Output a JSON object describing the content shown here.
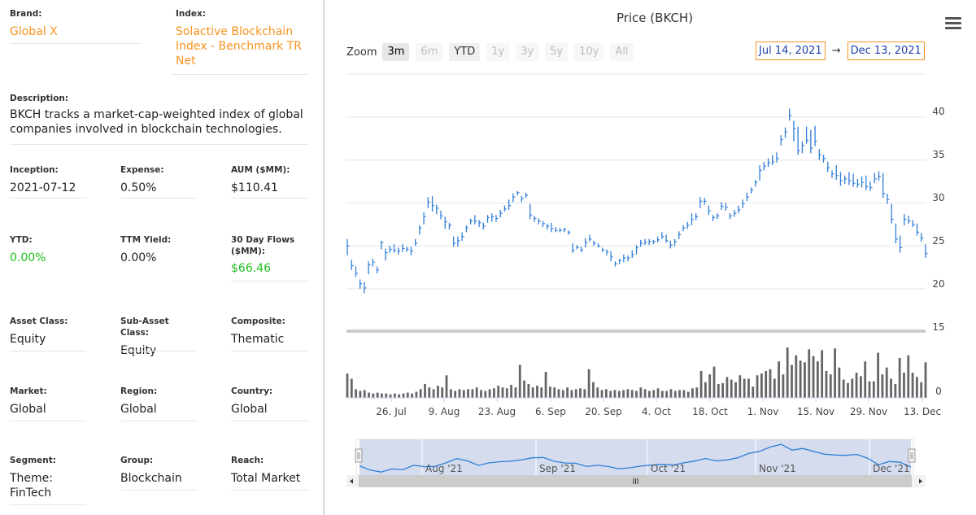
{
  "info": {
    "brand": {
      "label": "Brand:",
      "value": "Global X"
    },
    "index": {
      "label": "Index:",
      "value_lines": [
        "Solactive Blockchain",
        "Index - Benchmark TR",
        "Net"
      ]
    },
    "description": {
      "label": "Description:",
      "value_lines": [
        "BKCH tracks a market-cap-weighted index of global",
        "companies involved in blockchain technologies."
      ]
    },
    "inception": {
      "label": "Inception:",
      "value": "2021-07-12"
    },
    "expense": {
      "label": "Expense:",
      "value": "0.50%"
    },
    "aum": {
      "label": "AUM ($MM):",
      "value": "$110.41"
    },
    "ytd": {
      "label": "YTD:",
      "value": "0.00%"
    },
    "ttm_yield": {
      "label": "TTM Yield:",
      "value": "0.00%"
    },
    "flows": {
      "label_lines": [
        "30 Day Flows",
        "($MM):"
      ],
      "value": "$66.46"
    },
    "asset_class": {
      "label": "Asset Class:",
      "value": "Equity"
    },
    "sub_asset_class": {
      "label": "Sub-Asset Class:",
      "value": "Equity"
    },
    "composite": {
      "label": "Composite:",
      "value": "Thematic"
    },
    "market": {
      "label": "Market:",
      "value": "Global"
    },
    "region": {
      "label": "Region:",
      "value": "Global"
    },
    "country": {
      "label": "Country:",
      "value": "Global"
    },
    "segment": {
      "label": "Segment:",
      "value_lines": [
        "Theme:",
        "FinTech"
      ]
    },
    "group": {
      "label": "Group:",
      "value": "Blockchain"
    },
    "reach": {
      "label": "Reach:",
      "value": "Total Market"
    }
  },
  "colors": {
    "accent_orange": "#f7931e",
    "positive_green": "#1fbf1f",
    "price_bar": "#2f7ed8",
    "volume_bar": "#666666",
    "range_text": "#1f3fa8",
    "navigator_fill": "#ccd6eb"
  },
  "toolbar": {
    "zoom_label": "Zoom",
    "buttons": [
      "3m",
      "6m",
      "YTD",
      "1y",
      "3y",
      "5y",
      "10y",
      "All"
    ],
    "button_states": [
      "active",
      "disabled",
      "enabled",
      "disabled",
      "disabled",
      "disabled",
      "disabled",
      "disabled"
    ],
    "range_from": "Jul 14, 2021",
    "range_arrow": "→",
    "range_to": "Dec 13, 2021",
    "menu_icon": "hamburger-menu-icon"
  },
  "chart_data": {
    "type": "ohlc",
    "title": "Price (BKCH)",
    "y_ticks": [
      "40",
      "35",
      "30",
      "25",
      "20",
      "15",
      "0"
    ],
    "price_ylim": [
      20,
      40
    ],
    "x_tick_labels": [
      "26. Jul",
      "9. Aug",
      "23. Aug",
      "6. Sep",
      "20. Sep",
      "4. Oct",
      "18. Oct",
      "1. Nov",
      "15. Nov",
      "29. Nov",
      "13. Dec"
    ],
    "navigator_labels": [
      "Aug '21",
      "Sep '21",
      "Oct '21",
      "Nov '21",
      "Dec '21"
    ],
    "price_series": {
      "name": "",
      "values": [
        [
          25.8,
          23.9,
          25.0
        ],
        [
          23.4,
          22.2,
          22.7
        ],
        [
          22.6,
          21.4,
          21.8
        ],
        [
          21.1,
          20.0,
          20.6
        ],
        [
          20.8,
          19.5,
          20.1
        ],
        [
          23.2,
          21.7,
          22.8
        ],
        [
          23.5,
          22.6,
          23.1
        ],
        [
          22.6,
          21.8,
          22.2
        ],
        [
          25.6,
          24.6,
          25.4
        ],
        [
          24.7,
          23.3,
          24.2
        ],
        [
          25.0,
          24.2,
          24.6
        ],
        [
          25.2,
          24.2,
          24.5
        ],
        [
          24.8,
          24.0,
          24.4
        ],
        [
          25.2,
          24.3,
          24.7
        ],
        [
          24.9,
          24.3,
          24.6
        ],
        [
          24.9,
          23.9,
          24.4
        ],
        [
          25.8,
          25.0,
          25.3
        ],
        [
          27.4,
          26.3,
          27.1
        ],
        [
          28.9,
          27.5,
          28.4
        ],
        [
          30.7,
          29.4,
          30.1
        ],
        [
          30.8,
          29.0,
          29.7
        ],
        [
          29.8,
          28.7,
          29.4
        ],
        [
          29.1,
          28.1,
          28.5
        ],
        [
          28.4,
          27.0,
          27.8
        ],
        [
          27.7,
          26.9,
          27.4
        ],
        [
          26.1,
          24.9,
          25.3
        ],
        [
          26.1,
          24.9,
          25.6
        ],
        [
          26.6,
          25.6,
          26.1
        ],
        [
          27.4,
          26.6,
          27.1
        ],
        [
          28.2,
          27.5,
          27.9
        ],
        [
          28.6,
          27.5,
          27.9
        ],
        [
          28.0,
          27.2,
          27.7
        ],
        [
          27.7,
          26.9,
          27.3
        ],
        [
          28.6,
          27.7,
          28.3
        ],
        [
          28.8,
          27.8,
          28.4
        ],
        [
          28.6,
          27.8,
          28.2
        ],
        [
          29.2,
          28.3,
          28.8
        ],
        [
          29.7,
          29.0,
          29.3
        ],
        [
          30.4,
          29.2,
          29.7
        ],
        [
          31.1,
          30.1,
          30.7
        ],
        [
          31.4,
          30.9,
          31.2
        ],
        [
          30.8,
          30.1,
          30.5
        ],
        [
          31.2,
          30.6,
          30.9
        ],
        [
          29.9,
          28.1,
          28.6
        ],
        [
          28.5,
          27.8,
          28.2
        ],
        [
          28.2,
          27.5,
          27.9
        ],
        [
          27.9,
          27.2,
          27.6
        ],
        [
          27.6,
          26.9,
          27.3
        ],
        [
          27.7,
          26.6,
          27.0
        ],
        [
          27.2,
          26.6,
          26.8
        ],
        [
          27.1,
          26.6,
          26.8
        ],
        [
          27.1,
          26.6,
          26.9
        ],
        [
          26.8,
          26.3,
          26.6
        ],
        [
          25.3,
          24.2,
          24.5
        ],
        [
          25.1,
          24.6,
          24.8
        ],
        [
          24.9,
          24.3,
          24.5
        ],
        [
          25.9,
          24.8,
          25.4
        ],
        [
          26.3,
          25.5,
          25.8
        ],
        [
          25.6,
          25.0,
          25.3
        ],
        [
          25.3,
          24.8,
          25.0
        ],
        [
          24.8,
          24.3,
          24.5
        ],
        [
          24.6,
          23.9,
          24.3
        ],
        [
          24.4,
          23.2,
          23.7
        ],
        [
          23.2,
          22.6,
          22.9
        ],
        [
          23.5,
          22.9,
          23.3
        ],
        [
          24.0,
          23.1,
          23.6
        ],
        [
          23.9,
          23.2,
          23.6
        ],
        [
          24.5,
          23.6,
          24.0
        ],
        [
          25.1,
          24.0,
          24.8
        ],
        [
          25.7,
          24.9,
          25.3
        ],
        [
          25.8,
          25.1,
          25.4
        ],
        [
          25.8,
          25.1,
          25.5
        ],
        [
          25.7,
          25.2,
          25.5
        ],
        [
          26.1,
          25.4,
          25.7
        ],
        [
          26.6,
          25.8,
          26.1
        ],
        [
          26.3,
          25.4,
          25.6
        ],
        [
          25.6,
          24.7,
          25.1
        ],
        [
          25.8,
          25.0,
          25.5
        ],
        [
          26.7,
          25.8,
          26.3
        ],
        [
          27.4,
          26.7,
          27.1
        ],
        [
          27.8,
          27.0,
          27.4
        ],
        [
          28.8,
          27.4,
          28.1
        ],
        [
          28.8,
          28.0,
          28.4
        ],
        [
          30.7,
          29.4,
          30.2
        ],
        [
          30.6,
          29.8,
          30.2
        ],
        [
          29.7,
          28.6,
          29.1
        ],
        [
          28.6,
          27.9,
          28.3
        ],
        [
          28.8,
          28.1,
          28.5
        ],
        [
          30.1,
          29.2,
          29.6
        ],
        [
          30.0,
          29.1,
          29.5
        ],
        [
          28.8,
          28.1,
          28.5
        ],
        [
          29.2,
          28.4,
          28.8
        ],
        [
          29.7,
          28.8,
          29.2
        ],
        [
          30.4,
          29.4,
          29.9
        ],
        [
          31.2,
          30.2,
          30.7
        ],
        [
          31.8,
          31.1,
          31.5
        ],
        [
          32.7,
          31.9,
          32.4
        ],
        [
          34.4,
          32.6,
          33.8
        ],
        [
          34.8,
          33.8,
          34.3
        ],
        [
          35.2,
          34.2,
          34.7
        ],
        [
          35.6,
          34.4,
          34.8
        ],
        [
          35.9,
          34.7,
          35.2
        ],
        [
          37.9,
          36.7,
          37.4
        ],
        [
          38.8,
          37.6,
          38.3
        ],
        [
          41.0,
          39.6,
          40.2
        ],
        [
          39.6,
          37.2,
          38.7
        ],
        [
          38.9,
          35.6,
          36.1
        ],
        [
          37.2,
          35.8,
          36.7
        ],
        [
          38.9,
          36.9,
          37.3
        ],
        [
          38.5,
          35.8,
          36.4
        ],
        [
          39.0,
          36.6,
          37.2
        ],
        [
          36.3,
          35.0,
          35.6
        ],
        [
          35.6,
          34.7,
          35.2
        ],
        [
          34.8,
          33.6,
          34.1
        ],
        [
          33.8,
          32.9,
          33.4
        ],
        [
          34.4,
          32.7,
          33.2
        ],
        [
          33.6,
          32.0,
          32.6
        ],
        [
          33.2,
          32.2,
          32.8
        ],
        [
          33.6,
          32.1,
          32.6
        ],
        [
          33.4,
          31.9,
          32.3
        ],
        [
          32.8,
          31.8,
          32.2
        ],
        [
          33.1,
          31.8,
          32.4
        ],
        [
          33.2,
          31.5,
          31.9
        ],
        [
          32.5,
          31.4,
          31.8
        ],
        [
          33.5,
          32.3,
          32.8
        ],
        [
          33.7,
          32.6,
          33.1
        ],
        [
          33.5,
          30.6,
          31.1
        ],
        [
          31.1,
          29.9,
          30.4
        ],
        [
          29.9,
          27.6,
          28.1
        ],
        [
          27.6,
          25.3,
          25.8
        ],
        [
          26.2,
          24.2,
          24.8
        ],
        [
          28.7,
          27.4,
          28.1
        ],
        [
          28.5,
          27.6,
          27.9
        ],
        [
          28.0,
          27.2,
          27.5
        ],
        [
          27.6,
          26.2,
          26.6
        ],
        [
          26.5,
          25.5,
          25.9
        ],
        [
          25.2,
          23.6,
          24.1
        ]
      ]
    },
    "volume_series": {
      "name": "",
      "values": [
        28,
        22,
        10,
        8,
        9,
        6,
        5,
        6,
        5,
        5,
        4,
        5,
        4,
        5,
        6,
        5,
        7,
        10,
        16,
        12,
        10,
        14,
        12,
        26,
        10,
        8,
        10,
        9,
        10,
        10,
        12,
        9,
        8,
        10,
        11,
        14,
        12,
        11,
        15,
        12,
        38,
        20,
        16,
        12,
        14,
        12,
        30,
        13,
        12,
        10,
        9,
        12,
        9,
        10,
        11,
        10,
        33,
        18,
        12,
        9,
        10,
        8,
        9,
        8,
        9,
        10,
        9,
        8,
        12,
        10,
        8,
        9,
        11,
        8,
        8,
        10,
        8,
        9,
        9,
        7,
        11,
        12,
        31,
        18,
        27,
        36,
        16,
        17,
        24,
        21,
        18,
        26,
        22,
        22,
        13,
        26,
        28,
        31,
        33,
        22,
        42,
        27,
        58,
        38,
        49,
        43,
        41,
        56,
        48,
        42,
        55,
        31,
        27,
        57,
        35,
        21,
        17,
        22,
        29,
        25,
        42,
        19,
        19,
        52,
        27,
        35,
        22,
        16,
        46,
        29,
        49,
        29,
        24,
        18,
        41
      ]
    },
    "navigator_series": {
      "name": "",
      "values": [
        25.0,
        22.0,
        20.6,
        22.8,
        22.2,
        25.4,
        24.4,
        24.6,
        27.1,
        30.1,
        28.5,
        25.3,
        27.1,
        27.9,
        28.3,
        29.3,
        30.7,
        30.9,
        28.2,
        27.0,
        26.8,
        24.5,
        25.4,
        24.5,
        22.9,
        23.6,
        24.8,
        25.5,
        26.1,
        25.5,
        27.1,
        28.4,
        30.2,
        28.5,
        29.2,
        30.7,
        33.8,
        35.2,
        38.3,
        40.2,
        36.1,
        37.3,
        35.2,
        33.2,
        32.6,
        32.4,
        33.1,
        30.4,
        25.8,
        28.1,
        27.5,
        24.1
      ]
    }
  }
}
